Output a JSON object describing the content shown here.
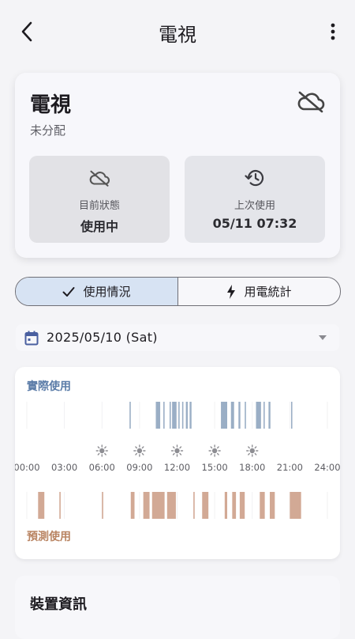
{
  "header": {
    "title": "電視"
  },
  "device": {
    "name": "電視",
    "group": "未分配"
  },
  "status": {
    "current_label": "目前狀態",
    "current_value": "使用中",
    "last_label": "上次使用",
    "last_value": "05/11 07:32"
  },
  "tabs": [
    {
      "label": "使用情況",
      "active": true
    },
    {
      "label": "用電統計",
      "active": false
    }
  ],
  "date_selector": {
    "value": "2025/05/10 (Sat)"
  },
  "usage": {
    "actual_label": "實際使用",
    "predicted_label": "預測使用",
    "times": [
      "00:00",
      "03:00",
      "06:00",
      "09:00",
      "12:00",
      "15:00",
      "18:00",
      "21:00",
      "24:00"
    ],
    "time_icons": [
      "moon-icon",
      "moon-icon",
      "sun-icon",
      "sun-icon",
      "sun-icon",
      "sun-icon",
      "sun-icon",
      "moon-icon",
      "moon-icon"
    ],
    "actual_color": "#9aaec5",
    "predicted_color": "#d2a995",
    "actual_intervals": [
      [
        8.2,
        8.3
      ],
      [
        10.3,
        10.65
      ],
      [
        10.9,
        11.0
      ],
      [
        11.4,
        11.5
      ],
      [
        11.6,
        11.95
      ],
      [
        12.1,
        12.2
      ],
      [
        12.4,
        12.5
      ],
      [
        12.7,
        12.85
      ],
      [
        13.0,
        13.15
      ],
      [
        15.5,
        16.0
      ],
      [
        16.3,
        16.55
      ],
      [
        16.9,
        17.05
      ],
      [
        17.4,
        17.5
      ],
      [
        18.3,
        18.7
      ],
      [
        18.9,
        19.0
      ],
      [
        19.3,
        19.45
      ],
      [
        21.1,
        21.2
      ]
    ],
    "predicted_intervals": [
      [
        0.9,
        1.4
      ],
      [
        2.6,
        2.7
      ],
      [
        6.0,
        6.1
      ],
      [
        8.3,
        8.6
      ],
      [
        9.3,
        9.8
      ],
      [
        10.0,
        11.0
      ],
      [
        11.2,
        11.9
      ],
      [
        13.3,
        13.4
      ],
      [
        14.0,
        14.5
      ],
      [
        15.8,
        16.0
      ],
      [
        16.4,
        16.7
      ],
      [
        17.0,
        17.4
      ],
      [
        18.6,
        19.0
      ],
      [
        19.4,
        19.8
      ],
      [
        21.0,
        21.9
      ]
    ]
  },
  "device_info": {
    "title": "裝置資訊"
  }
}
